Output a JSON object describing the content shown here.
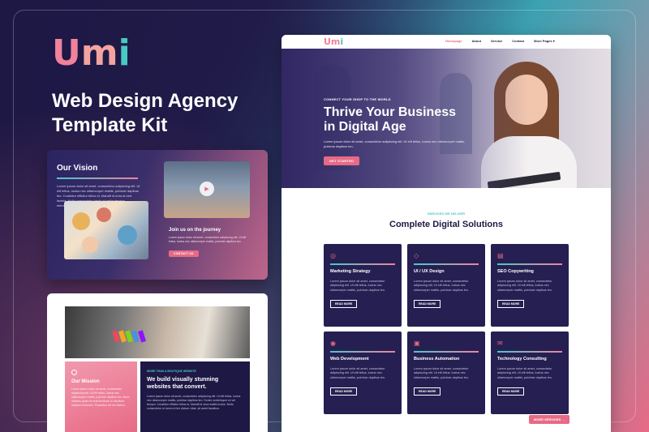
{
  "promo": {
    "logo_text": [
      "U",
      "m",
      "i"
    ],
    "title_lines": [
      "Web Design Agency",
      "Template Kit"
    ]
  },
  "vision_card": {
    "title": "Our Vision",
    "body": "Lorem ipsum dolor sit amet, consectetur adipiscing elit. Ut elit tellus, luctus nec ullamcorper mattis, pulvinar dapibus leo. Curabitur efficitur tellus et, blandit id urna at sed lacinia. Nulla consectetur turpis et pellentesque elementum.",
    "journey_title": "Join us on the journey",
    "journey_body": "Lorem ipsum dolor sit amet, consectetur adipiscing elit. Ut elit tellus, luctus nec ullamcorper mattis, pulvinar dapibus leo.",
    "journey_button": "CONTACT US"
  },
  "mission_card": {
    "title": "Our Mission",
    "body": "Lorem ipsum dolor sit amet, consectetur adipiscing elit. Ut elit tellus, luctus nec ullamcorper mattis, pulvinar dapibus leo. Nunc ultricies quam et erat tincidunt, in faucibus massa commodo. Phasellus vel dui dictum.",
    "kicker": "MORE THAN A BOUTIQUE WEBSITE",
    "heading": "We build visually stunning websites that convert.",
    "dark_body": "Lorem ipsum dolor sit amet, consectetur adipiscing elit. Ut elit tellus, luctus nec ullamcorper mattis, pulvinar dapibus leo. Donec scelerisque ex vel tempor. Curabitur efficitur tellus et, blandit id urna mattis luctus. Nulla consectetur ut lorem id leo dictum vitae, sit amet faucibus."
  },
  "site": {
    "logo": [
      "Um",
      "i"
    ],
    "nav": [
      "Homepage",
      "About",
      "Service",
      "Contact",
      "More Pages"
    ],
    "hero": {
      "kicker": "CONNECT YOUR SHOP TO THE WORLD",
      "title_lines": [
        "Thrive Your Business",
        "in Digital Age"
      ],
      "body": "Lorem ipsum dolor sit amet, consectetur adipiscing elit. Ut elit tellus, luctus nec ullamcorper mattis, pulvinar dapibus leo.",
      "button": "GET STARTED"
    },
    "services_kicker": "SERVICES WE DELIVER",
    "services_title": "Complete Digital Solutions",
    "card_body": "Lorem ipsum dolor sit amet, consectetur adipiscing elit. Ut elit tellus, luctus nec ullamcorper mattis, pulvinar dapibus leo.",
    "card_button": "READ MORE",
    "cards": [
      {
        "title": "Marketing Strategy",
        "icon": "target-icon"
      },
      {
        "title": "UI / UX Design",
        "icon": "diamond-icon"
      },
      {
        "title": "SEO Copywriting",
        "icon": "document-icon"
      },
      {
        "title": "Web Development",
        "icon": "globe-icon"
      },
      {
        "title": "Business Automation",
        "icon": "briefcase-icon"
      },
      {
        "title": "Technology Consulting",
        "icon": "chat-icon"
      }
    ],
    "more_button": "MORE SERVICES"
  },
  "colors": {
    "navy": "#1e1845",
    "pink": "#e86a86",
    "teal": "#48c9c4",
    "card": "#251f52"
  }
}
